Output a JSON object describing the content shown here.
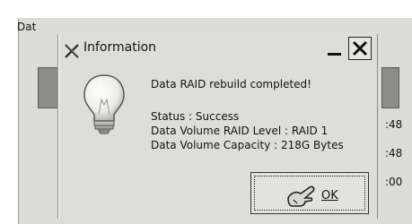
{
  "background": {
    "title_text": "Dat",
    "times": [
      ":48",
      ":48",
      ":00"
    ]
  },
  "dialog": {
    "title": "Information",
    "headline": "Data RAID rebuild completed!",
    "status_line": "Status : Success",
    "raid_level_line": "Data Volume RAID Level : RAID 1",
    "capacity_line": "Data Volume Capacity : 218G Bytes",
    "ok_label": "OK"
  }
}
